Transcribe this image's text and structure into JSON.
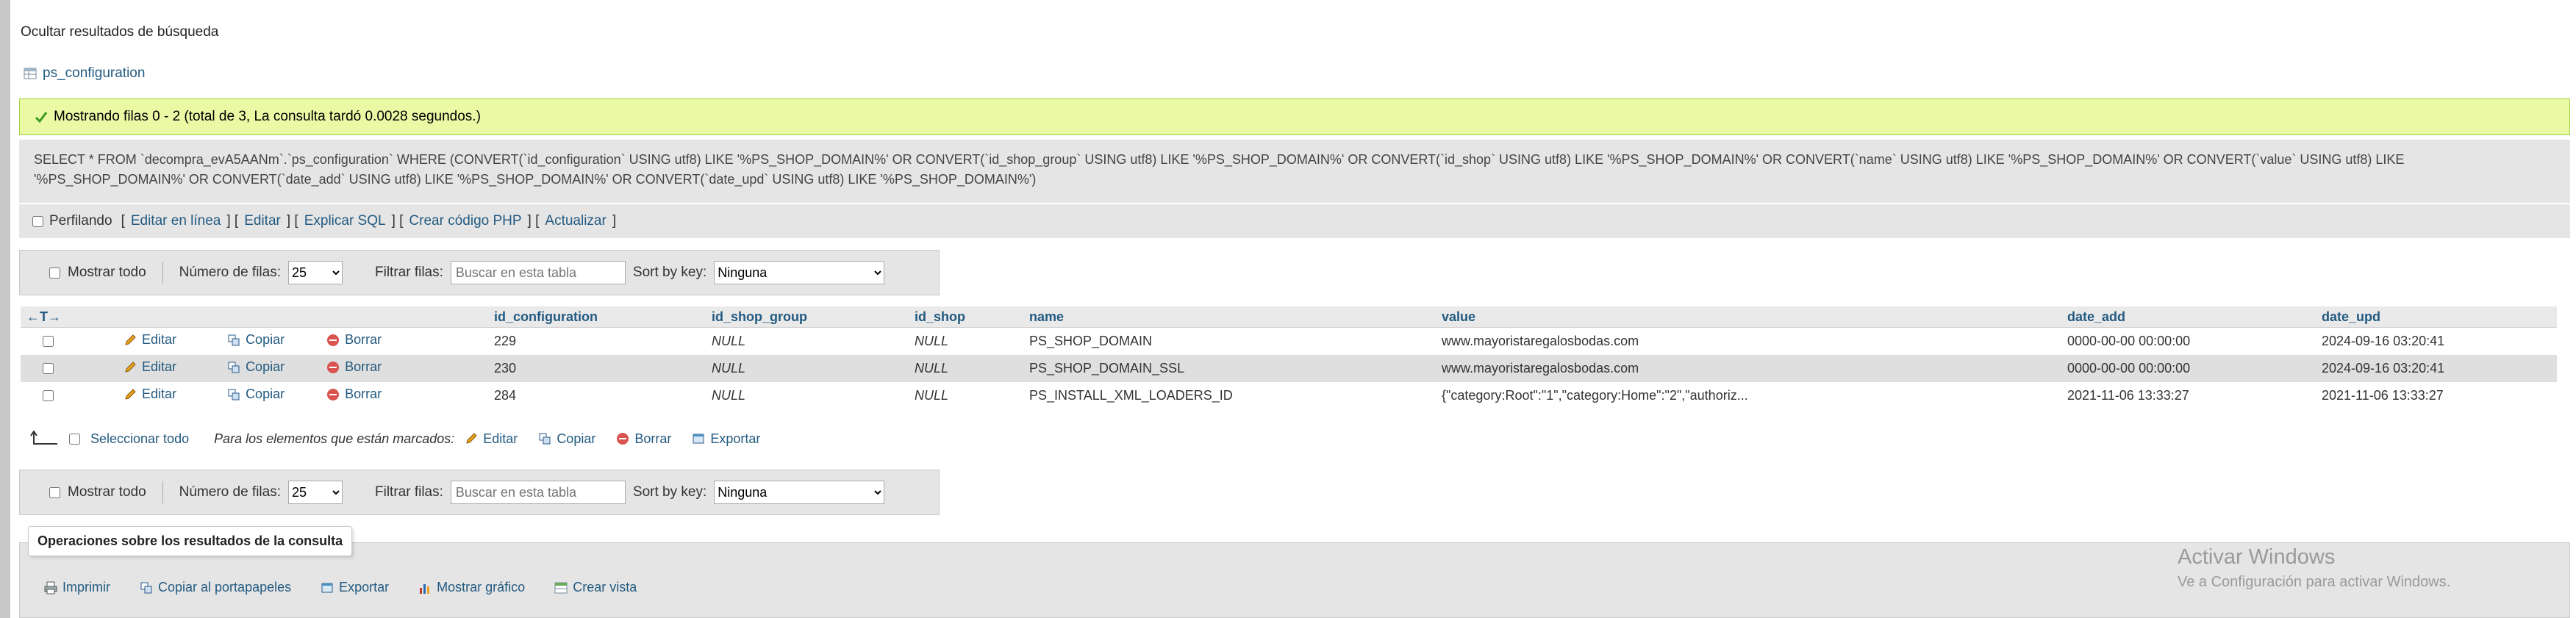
{
  "hide_results": "Ocultar resultados de búsqueda",
  "table_name": "ps_configuration",
  "success_message": "Mostrando filas 0 - 2 (total de 3, La consulta tardó 0.0028 segundos.)",
  "sql": {
    "line1": "SELECT * FROM `decompra_evA5AANm`.`ps_configuration` WHERE (CONVERT(`id_configuration` USING utf8) LIKE '%PS_SHOP_DOMAIN%' OR CONVERT(`id_shop_group` USING utf8) LIKE '%PS_SHOP_DOMAIN%' OR CONVERT(`id_shop` USING utf8) LIKE '%PS_SHOP_DOMAIN%' OR CONVERT(`name` USING utf8) LIKE '%PS_SHOP_DOMAIN%' OR CONVERT(`value` USING utf8) LIKE",
    "line2": "'%PS_SHOP_DOMAIN%' OR CONVERT(`date_add` USING utf8) LIKE '%PS_SHOP_DOMAIN%' OR CONVERT(`date_upd` USING utf8) LIKE '%PS_SHOP_DOMAIN%')"
  },
  "profiling": {
    "label": "Perfilando",
    "links": [
      "Editar en línea",
      "Editar",
      "Explicar SQL",
      "Crear código PHP",
      "Actualizar"
    ]
  },
  "navbar": {
    "show_all": "Mostrar todo",
    "rows_label": "Número de filas:",
    "rows_value": "25",
    "filter_label": "Filtrar filas:",
    "filter_placeholder": "Buscar en esta tabla",
    "sort_label": "Sort by key:",
    "sort_value": "Ninguna"
  },
  "table": {
    "headers": [
      "id_configuration",
      "id_shop_group",
      "id_shop",
      "name",
      "value",
      "date_add",
      "date_upd"
    ],
    "actions": {
      "edit": "Editar",
      "copy": "Copiar",
      "delete": "Borrar"
    },
    "rows": [
      [
        "229",
        "NULL",
        "NULL",
        "PS_SHOP_DOMAIN",
        "www.mayoristaregalosbodas.com",
        "0000-00-00 00:00:00",
        "2024-09-16 03:20:41"
      ],
      [
        "230",
        "NULL",
        "NULL",
        "PS_SHOP_DOMAIN_SSL",
        "www.mayoristaregalosbodas.com",
        "0000-00-00 00:00:00",
        "2024-09-16 03:20:41"
      ],
      [
        "284",
        "NULL",
        "NULL",
        "PS_INSTALL_XML_LOADERS_ID",
        "{\"category:Root\":\"1\",\"category:Home\":\"2\",\"authoriz...",
        "2021-11-06 13:33:27",
        "2021-11-06 13:33:27"
      ]
    ]
  },
  "marked": {
    "select_all": "Seleccionar todo",
    "label": "Para los elementos que están marcados:",
    "edit": "Editar",
    "copy": "Copiar",
    "delete": "Borrar",
    "export": "Exportar"
  },
  "operations": {
    "title": "Operaciones sobre los resultados de la consulta",
    "links": [
      "Imprimir",
      "Copiar al portapapeles",
      "Exportar",
      "Mostrar gráfico",
      "Crear vista"
    ]
  },
  "watermark": {
    "title": "Activar Windows",
    "subtitle": "Ve a Configuración para activar Windows."
  },
  "colors": {
    "link": "#235a81",
    "success_bg": "#ebf8a4",
    "panel_bg": "#e5e5e5",
    "row_alt": "#dfdfdf",
    "delete_red": "#d9534f"
  }
}
